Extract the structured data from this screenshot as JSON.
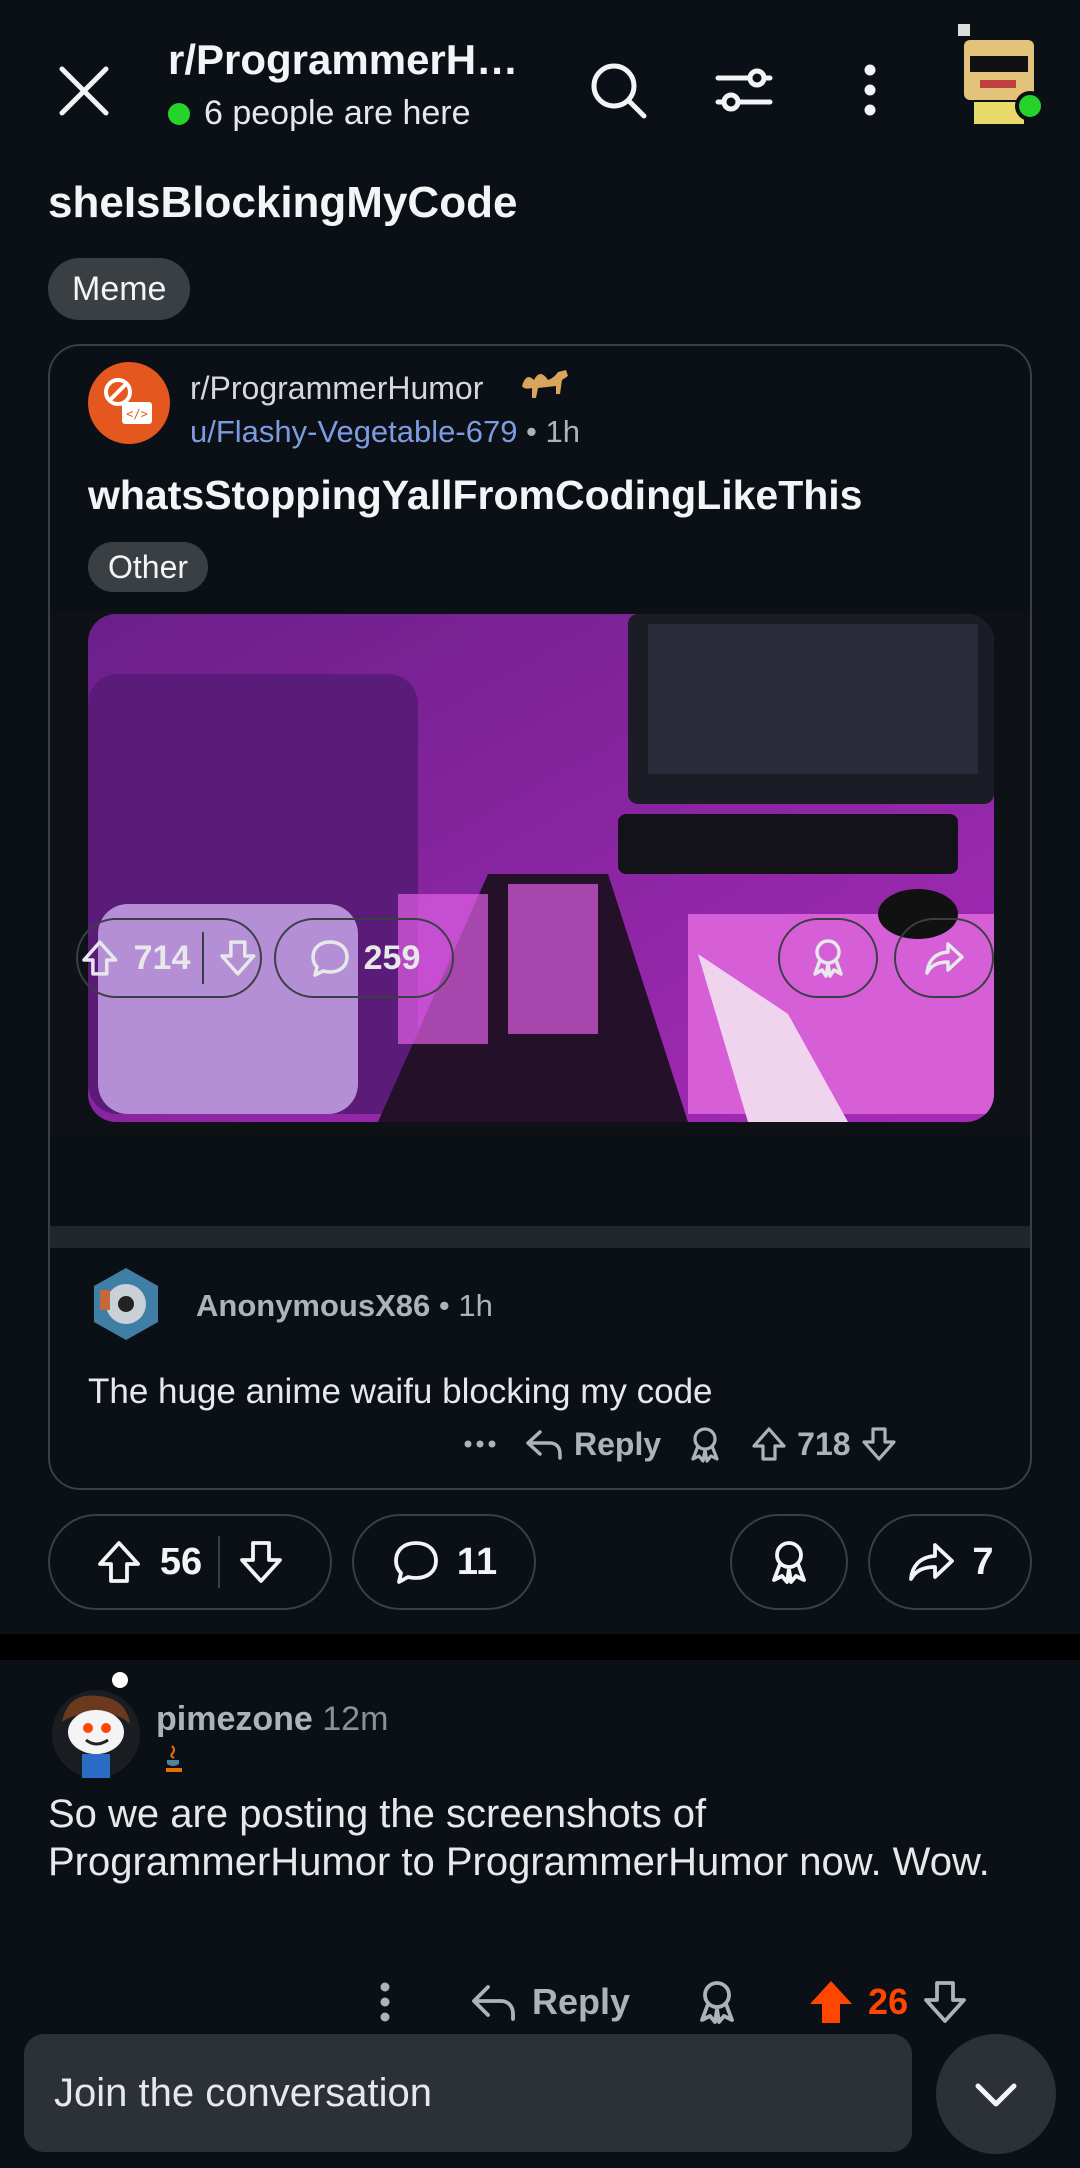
{
  "header": {
    "subreddit": "r/ProgrammerHu...",
    "presence": "6 people are here"
  },
  "post": {
    "title": "sheIsBlockingMyCode",
    "flair": "Meme",
    "upvotes": "56",
    "comments": "11",
    "shares": "7"
  },
  "crosspost": {
    "subreddit": "r/ProgrammerHumor",
    "user": "u/Flashy-Vegetable-679",
    "time": " • 1h",
    "title": "whatsStoppingYallFromCodingLikeThis",
    "flair": "Other",
    "upvotes": "714",
    "comments": "259",
    "comment": {
      "user": "AnonymousX86",
      "time": " • 1h",
      "text": "The huge anime waifu blocking my code",
      "reply_label": "Reply",
      "score": "718"
    }
  },
  "comment": {
    "user": "pimezone",
    "time": "12m",
    "text": "So we are posting the screenshots of ProgrammerHumor to ProgrammerHumor now. Wow.",
    "reply_label": "Reply",
    "score": "26"
  },
  "composer": {
    "placeholder": "Join the conversation"
  },
  "colors": {
    "upvote_active": "#ff4500",
    "accent_link": "#7c9be0",
    "online": "#25d32a"
  }
}
